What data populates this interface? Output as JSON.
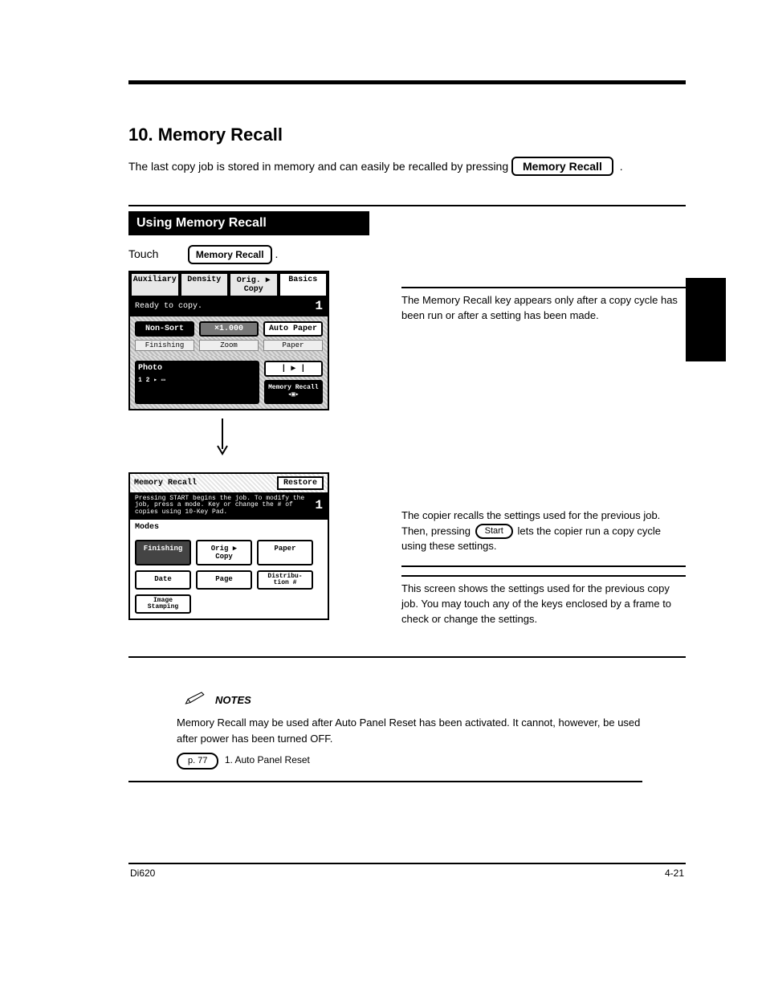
{
  "chapter": {
    "title": "10. Memory Recall",
    "subtitle_prefix": "The last copy job is stored in memory and can easily be recalled by pressing ",
    "key_label": "Memory Recall",
    "subtitle_suffix": "."
  },
  "section": {
    "header": "Using Memory Recall",
    "touch_label": "Touch",
    "touch_button": "Memory Recall"
  },
  "lcd1": {
    "tabs": [
      "Auxiliary",
      "Density",
      "Orig. ▶ Copy",
      "Basics"
    ],
    "status": "Ready to copy.",
    "count": "1",
    "row1": [
      "Non-Sort",
      "×1.000",
      "Auto Paper"
    ],
    "row2": [
      "Finishing",
      "Zoom",
      "Paper"
    ],
    "photo": "Photo",
    "memory_recall": "Memory Recall"
  },
  "lcd2": {
    "title": "Memory Recall",
    "restore": "Restore",
    "instruction": "Pressing START begins the job. To modify the job, press a mode. Key or change the # of copies using 10-Key Pad.",
    "count": "1",
    "modes_header": "Modes",
    "modes": [
      "Finishing",
      "Orig ▶ Copy",
      "Paper",
      "Date",
      "Page",
      "Distribu-\ntion #",
      "Image\nStamping"
    ]
  },
  "right": {
    "p1": "The Memory Recall key appears only after a copy cycle has been run or after a setting has been made.",
    "p2a": "The copier recalls the settings used for the previous job. Then, pressing ",
    "start_key": "Start",
    "p2b": " lets the copier run a copy cycle using these settings.",
    "p3": "This screen shows the settings used for the previous copy job. You may touch any of the keys enclosed by a frame to check or change the settings."
  },
  "notes": {
    "label": "NOTES",
    "body": "Memory Recall may be used after Auto Panel Reset has been activated. It cannot, however, be used after power has been turned OFF.",
    "ref_page": "p. 77",
    "ref_text": "1. Auto Panel Reset"
  },
  "footer": {
    "model": "Di620",
    "page": "4-21"
  }
}
